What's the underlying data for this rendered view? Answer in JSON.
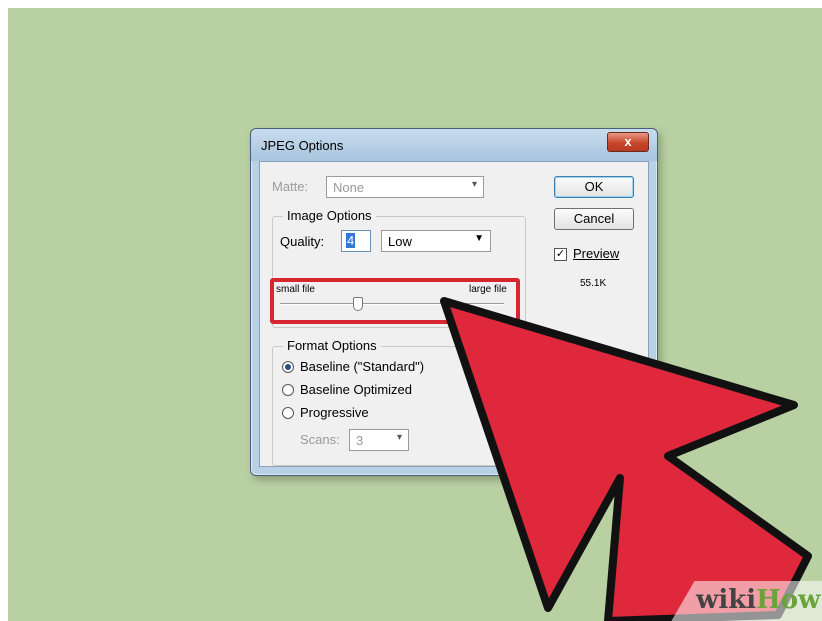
{
  "dialog": {
    "title": "JPEG Options",
    "close_glyph": "x",
    "matte_label": "Matte:",
    "matte_value": "None",
    "image_options": {
      "title": "Image Options",
      "quality_label": "Quality:",
      "quality_value": "4",
      "quality_preset": "Low",
      "small_label": "small file",
      "large_label": "large file",
      "slider_fraction": 0.35
    },
    "format_options": {
      "title": "Format Options",
      "options": [
        "Baseline (\"Standard\")",
        "Baseline Optimized",
        "Progressive"
      ],
      "selected": 0,
      "scans_label": "Scans:",
      "scans_value": "3"
    },
    "buttons": {
      "ok": "OK",
      "cancel": "Cancel"
    },
    "preview_label": "Preview",
    "preview_checked": true,
    "file_size": "55.1K"
  },
  "watermark": {
    "wiki": "wiki",
    "how": "How"
  },
  "colors": {
    "background": "#b9d0a3",
    "highlight": "#d6262f",
    "arrow": "#e0283c"
  }
}
